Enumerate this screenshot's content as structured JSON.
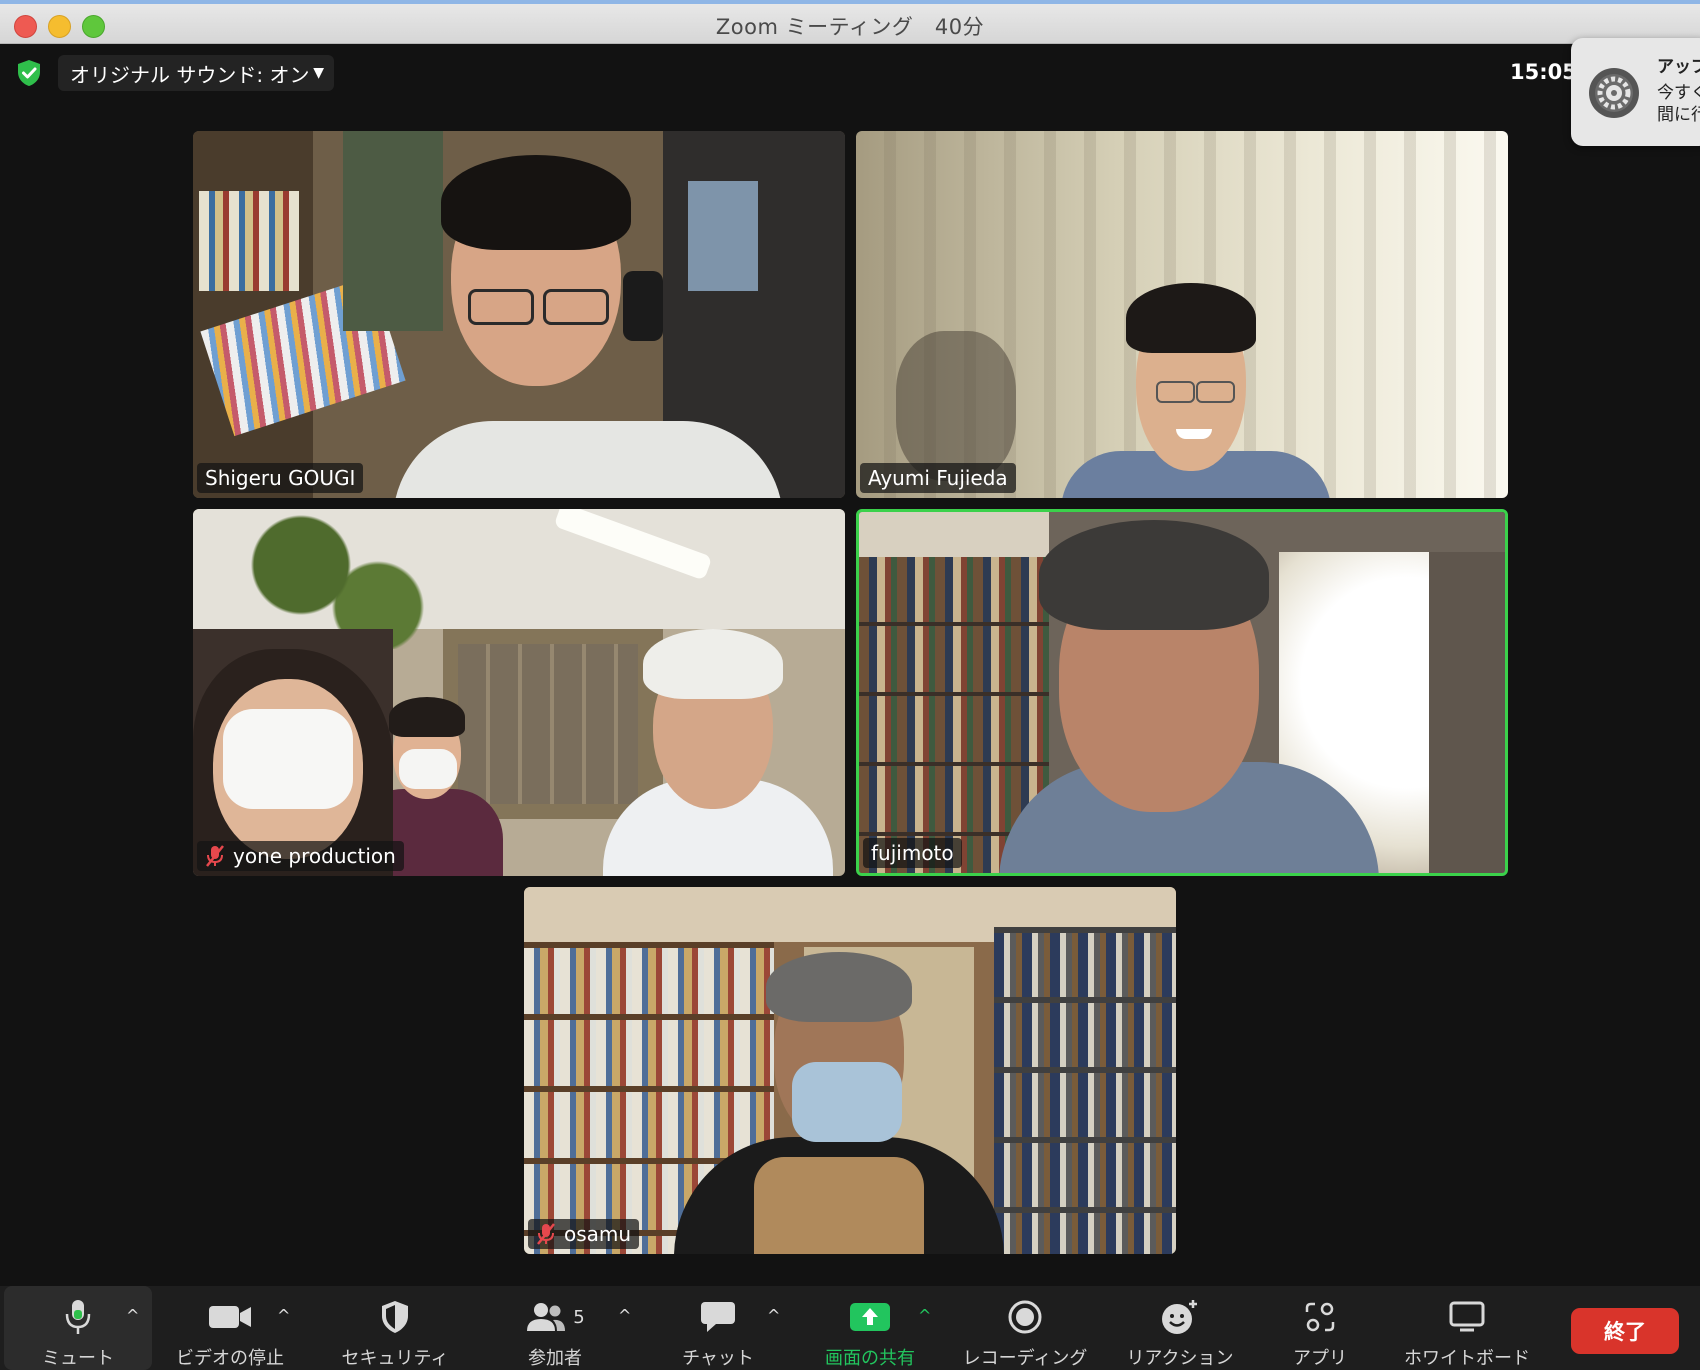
{
  "window": {
    "title": "Zoom ミーティング　40分"
  },
  "top_bar": {
    "sound_label": "オリジナル サウンド: オン",
    "clock": "15:05"
  },
  "notification": {
    "line1": "アップ",
    "line2": "今すぐ",
    "line3": "間に行"
  },
  "participants": [
    {
      "name": "Shigeru GOUGI",
      "muted": false,
      "active": false
    },
    {
      "name": "Ayumi Fujieda",
      "muted": false,
      "active": false
    },
    {
      "name": "yone production",
      "muted": true,
      "active": false
    },
    {
      "name": "fujimoto",
      "muted": false,
      "active": true
    },
    {
      "name": "osamu",
      "muted": true,
      "active": false
    }
  ],
  "toolbar": {
    "mute_label": "ミュート",
    "video_label": "ビデオの停止",
    "security_label": "セキュリティ",
    "participants_label": "参加者",
    "participants_count": "5",
    "chat_label": "チャット",
    "share_label": "画面の共有",
    "record_label": "レコーディング",
    "reaction_label": "リアクション",
    "apps_label": "アプリ",
    "whiteboard_label": "ホワイトボード",
    "end_label": "終了"
  },
  "colors": {
    "active_speaker": "#3bd14b",
    "share_green": "#22c55e",
    "end_red": "#d9342b"
  }
}
